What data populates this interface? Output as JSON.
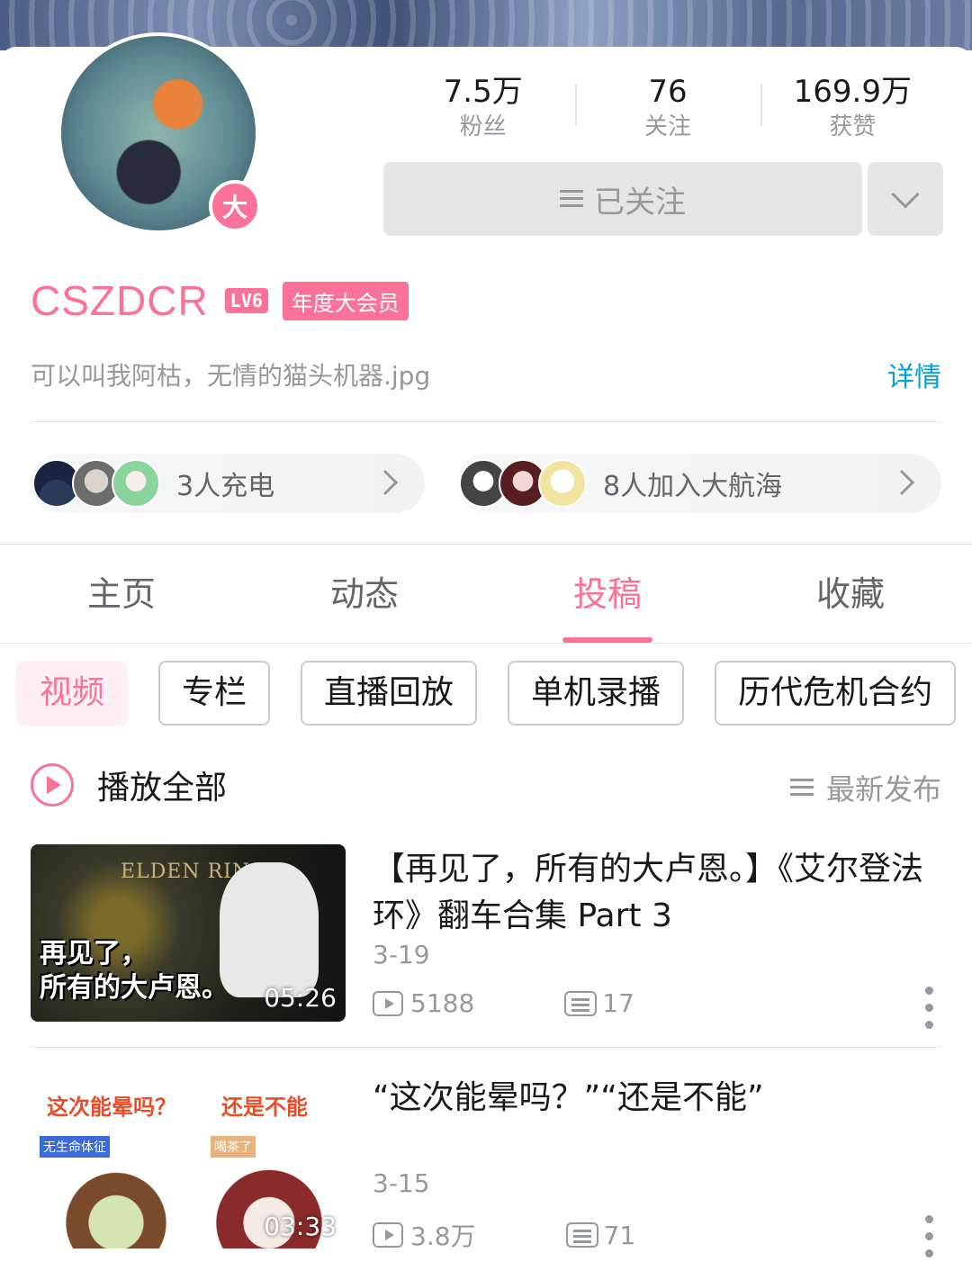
{
  "profile": {
    "username": "CSZDCR",
    "level": "LV6",
    "vip_label": "年度大会员",
    "avatar_badge": "大",
    "bio": "可以叫我阿枯，无情的猫头机器.jpg",
    "detail_label": "详情"
  },
  "stats": [
    {
      "value": "7.5万",
      "label": "粉丝"
    },
    {
      "value": "76",
      "label": "关注"
    },
    {
      "value": "169.9万",
      "label": "获赞"
    }
  ],
  "follow_button_label": "已关注",
  "supporters": {
    "charge_text": "3人充电",
    "fleet_text": "8人加入大航海"
  },
  "tabs": [
    {
      "label": "主页",
      "active": false
    },
    {
      "label": "动态",
      "active": false
    },
    {
      "label": "投稿",
      "active": true
    },
    {
      "label": "收藏",
      "active": false
    }
  ],
  "chips": [
    {
      "label": "视频",
      "active": true
    },
    {
      "label": "专栏",
      "active": false
    },
    {
      "label": "直播回放",
      "active": false
    },
    {
      "label": "单机录播",
      "active": false
    },
    {
      "label": "历代危机合约",
      "active": false
    }
  ],
  "play_all_label": "播放全部",
  "sort_label": "最新发布",
  "videos": [
    {
      "title": "【再见了，所有的大卢恩。】《艾尔登法环》翻车合集 Part 3",
      "date": "3-19",
      "views": "5188",
      "danmaku": "17",
      "duration": "05:26",
      "thumb_brand": "ELDEN RING",
      "thumb_caption_1": "再见了，",
      "thumb_caption_2": "所有的大卢恩。"
    },
    {
      "title": "“这次能晕吗？”“还是不能”",
      "date": "3-15",
      "views": "3.8万",
      "danmaku": "71",
      "duration": "03:33",
      "thumb_left_text": "这次能晕吗？",
      "thumb_right_text": "还是不能",
      "thumb_tag_left": "无生命体征",
      "thumb_tag_right": "喝茶了"
    }
  ],
  "colors": {
    "accent": "#fb7299",
    "link": "#00a1d6",
    "muted": "#9499a0"
  }
}
